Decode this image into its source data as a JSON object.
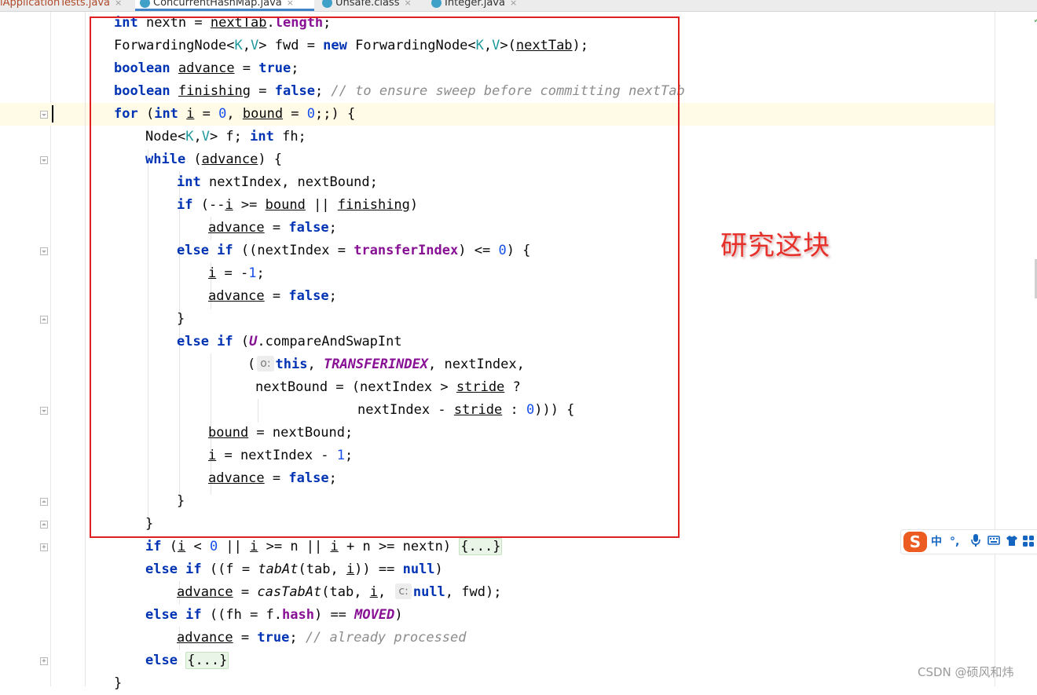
{
  "tabs": [
    {
      "label": "lApplicationTests.java",
      "active": false,
      "modified": true
    },
    {
      "label": "ConcurrentHashMap.java",
      "active": true,
      "modified": false
    },
    {
      "label": "Unsafe.class",
      "active": false,
      "modified": false
    },
    {
      "label": "Integer.java",
      "active": false,
      "modified": false
    }
  ],
  "tab_close_glyph": "×",
  "annotation": "研究这块",
  "hints": {
    "h1": "o:",
    "h2": "c:"
  },
  "folded": "{...}",
  "ime": {
    "logo": "S",
    "mode": "中",
    "punct": "°,",
    "mic": "mic-icon",
    "keyboard": "keyboard-icon",
    "skin": "shirt-icon",
    "grid": "grid-icon"
  },
  "watermark": "CSDN @硕风和炜",
  "colors": {
    "highlight_box": "#e02020",
    "annotation": "#e8302a",
    "keyword": "#0033b3",
    "field": "#871094",
    "comment": "#8c8c8c"
  }
}
